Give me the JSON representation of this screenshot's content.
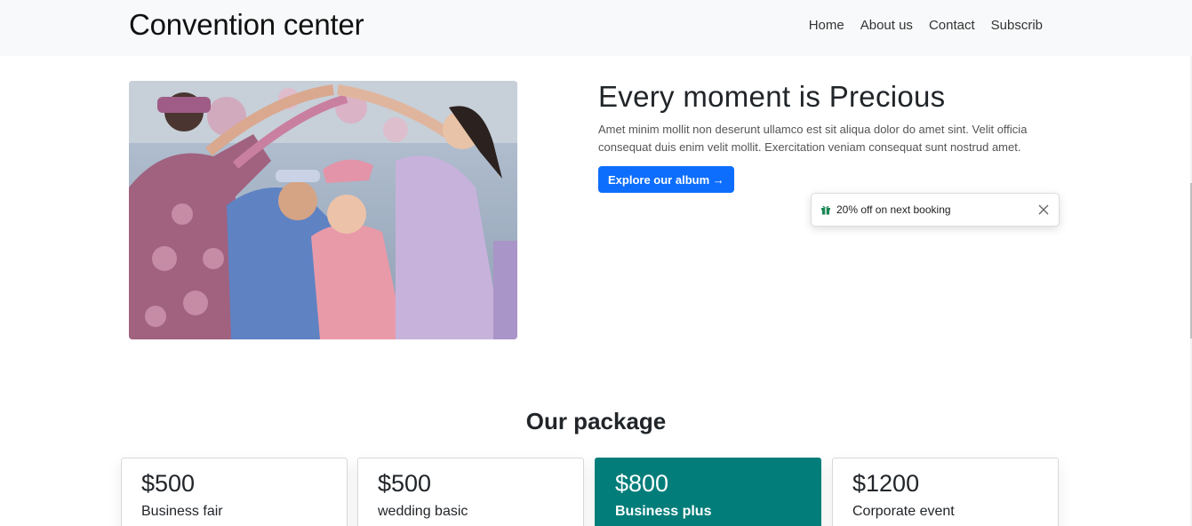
{
  "navbar": {
    "brand": "Convention center",
    "links": [
      "Home",
      "About us",
      "Contact",
      "Subscrib"
    ]
  },
  "hero": {
    "title": "Every moment is Precious",
    "text": "Amet minim mollit non deserunt ullamco est sit aliqua dolor do amet sint. Velit officia consequat duis enim velit mollit. Exercitation veniam consequat sunt nostrud amet.",
    "button_label": "Explore our album →",
    "image_icon": "wedding-photo"
  },
  "toast": {
    "icon": "gift-icon",
    "text": "20% off on next booking"
  },
  "packages": {
    "title": "Our package",
    "items": [
      {
        "price": "$500",
        "name": "Business fair",
        "featured": false
      },
      {
        "price": "$500",
        "name": "wedding basic",
        "featured": false
      },
      {
        "price": "$800",
        "name": "Business plus",
        "featured": true
      },
      {
        "price": "$1200",
        "name": "Corporate event",
        "featured": false
      }
    ]
  },
  "colors": {
    "primary": "#0d6efd",
    "featured": "#027d7a",
    "navbar_bg": "#f8f9fa",
    "gift": "#198754"
  }
}
